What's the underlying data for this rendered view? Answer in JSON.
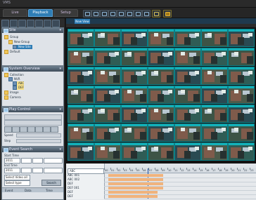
{
  "window": {
    "title": "VMS"
  },
  "tabs": [
    "Live",
    "Playback",
    "Setup"
  ],
  "active_tab": "Playback",
  "panels": {
    "device": {
      "title": "Site",
      "tree": [
        {
          "label": "Group",
          "type": "folder",
          "depth": 0
        },
        {
          "label": "New Group",
          "type": "folder",
          "depth": 1
        },
        {
          "label": "New Site",
          "type": "camera",
          "depth": 2,
          "selected": true
        },
        {
          "label": "Default",
          "type": "folder",
          "depth": 0
        }
      ]
    },
    "system_overview": {
      "title": "System Overview",
      "tree": [
        {
          "label": "Collection",
          "type": "folder",
          "depth": 0
        },
        {
          "label": "NVR",
          "type": "camera",
          "depth": 1
        },
        {
          "label": "ABC",
          "type": "camera",
          "depth": 2,
          "selected": true
        },
        {
          "label": "DEF",
          "type": "camera",
          "depth": 2,
          "selected": true
        },
        {
          "label": "Image",
          "type": "folder",
          "depth": 0
        },
        {
          "label": "Camera",
          "type": "folder",
          "depth": 0
        }
      ]
    },
    "play_control": {
      "title": "Play Control",
      "speed_label": "Speed",
      "step_label": "Step"
    },
    "event_search": {
      "title": "Event Search",
      "start_label": "Start Time",
      "end_label": "End Time",
      "start_date": "2011",
      "end_date": "2011",
      "select_label": "Select Video all",
      "type_label": "Select type",
      "search_button": "Search",
      "columns": [
        "Event",
        "Data",
        "Time"
      ]
    }
  },
  "grid": {
    "tab_label": "New View",
    "rows": 7,
    "cols": 7
  },
  "timeline": {
    "channel_label": "ABC",
    "channels": [
      "ABC 001",
      "ABC 002",
      "DEF",
      "DEF 001",
      "DEF",
      "DEF"
    ],
    "hour_labels": [
      "00",
      "01",
      "02",
      "03",
      "04",
      "05",
      "06",
      "07",
      "08",
      "09",
      "10",
      "11",
      "12",
      "13",
      "14",
      "15",
      "16",
      "17",
      "18",
      "19",
      "20",
      "21",
      "22",
      "23"
    ],
    "colors": {
      "record": "#f0b37d",
      "playhead": "#1d4fa5",
      "accent": "#2e7db5"
    }
  }
}
